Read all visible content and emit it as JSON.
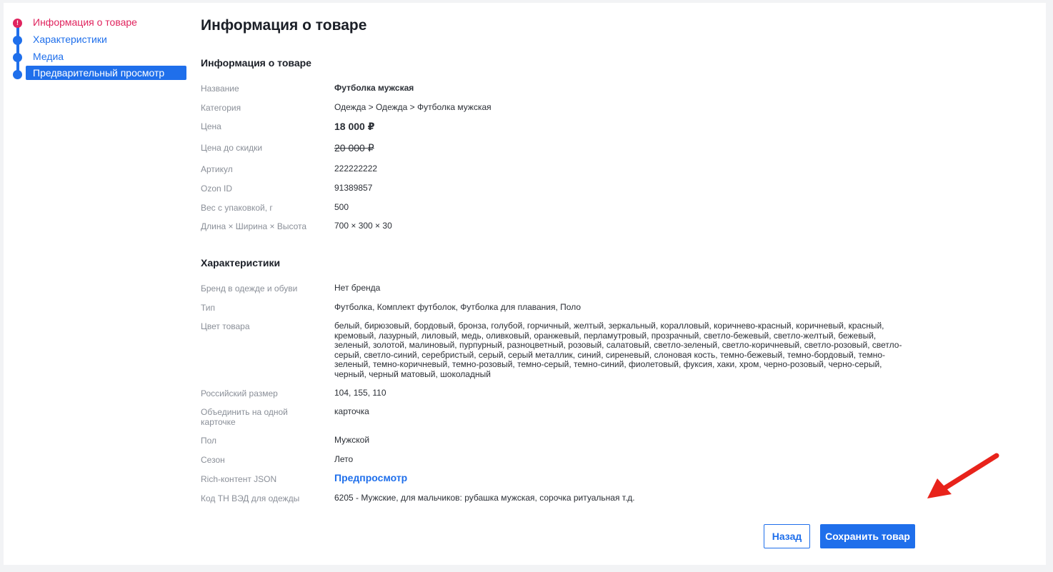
{
  "stepper": {
    "items": [
      {
        "label": "Информация о товаре",
        "state": "error",
        "badge": "!"
      },
      {
        "label": "Характеристики",
        "state": "done"
      },
      {
        "label": "Медиа",
        "state": "done"
      },
      {
        "label": "Предварительный просмотр",
        "state": "active"
      }
    ]
  },
  "page": {
    "title": "Информация о товаре"
  },
  "info": {
    "title": "Информация о товаре",
    "rows": [
      {
        "key": "Название",
        "value": "Футболка мужская"
      },
      {
        "key": "Категория",
        "value": "Одежда > Одежда > Футболка мужская"
      },
      {
        "key": "Цена",
        "value": "18 000 ₽"
      },
      {
        "key": "Цена до скидки",
        "value": "20 000 ₽"
      },
      {
        "key": "Артикул",
        "value": "222222222"
      },
      {
        "key": "Ozon ID",
        "value": "91389857"
      },
      {
        "key": "Вес с упаковкой, г",
        "value": "500"
      },
      {
        "key": "Длина × Ширина × Высота",
        "value": "700 × 300 × 30"
      }
    ]
  },
  "specs": {
    "title": "Характеристики",
    "rows": [
      {
        "key": "Бренд в одежде и обуви",
        "value": "Нет бренда"
      },
      {
        "key": "Тип",
        "value": "Футболка, Комплект футболок, Футболка для плавания, Поло"
      },
      {
        "key": "Цвет товара",
        "value": "белый, бирюзовый, бордовый, бронза, голубой, горчичный, желтый, зеркальный, коралловый, коричнево-красный, коричневый, красный, кремовый, лазурный, лиловый, медь, оливковый, оранжевый, перламутровый, прозрачный, светло-бежевый, светло-желтый, бежевый, зеленый, золотой, малиновый, пурпурный, разноцветный, розовый, салатовый, светло-зеленый, светло-коричневый, светло-розовый, светло-серый, светло-синий, серебристый, серый, серый металлик, синий, сиреневый, слоновая кость, темно-бежевый, темно-бордовый, темно-зеленый, темно-коричневый, темно-розовый, темно-серый, темно-синий, фиолетовый, фуксия, хаки, хром, черно-розовый, черно-серый, черный, черный матовый, шоколадный"
      },
      {
        "key": "Российский размер",
        "value": "104, 155, 110"
      },
      {
        "key": "Объединить на одной карточке",
        "value": "карточка"
      },
      {
        "key": "Пол",
        "value": "Мужской"
      },
      {
        "key": "Сезон",
        "value": "Лето"
      },
      {
        "key": "Rich-контент JSON",
        "value": "Предпросмотр"
      },
      {
        "key": "Код ТН ВЭД для одежды",
        "value": "6205 - Мужские, для мальчиков: рубашка мужская, сорочка ритуальная т.д."
      }
    ]
  },
  "actions": {
    "back_label": "Назад",
    "save_label": "Сохранить товар"
  },
  "colors": {
    "accent": "#1f6feb",
    "error": "#e0245e",
    "annotation": "#e8231b"
  }
}
